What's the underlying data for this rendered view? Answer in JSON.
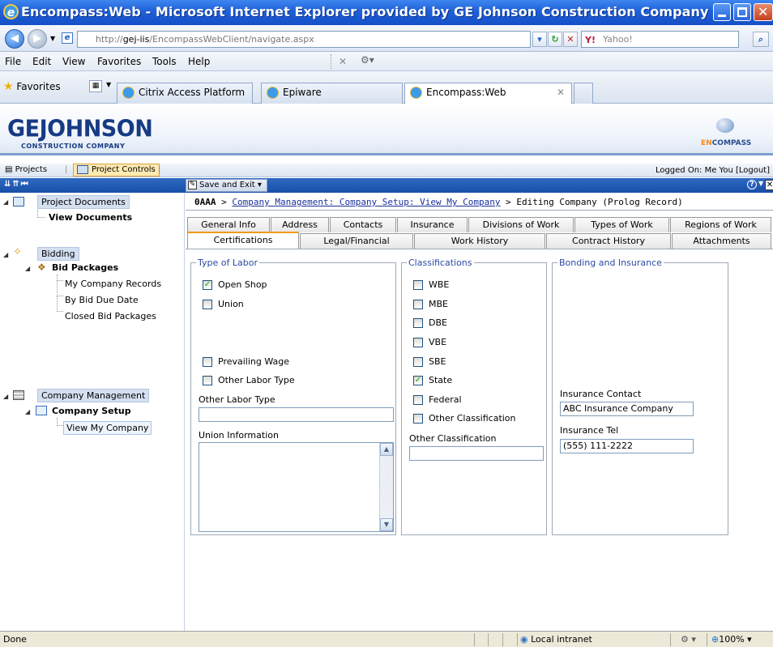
{
  "window": {
    "title": "Encompass:Web - Microsoft Internet Explorer provided by GE Johnson Construction Company"
  },
  "address": {
    "url_prefix": "http://",
    "url_host": "gej-iis",
    "url_path": "/EncompassWebClient/navigate.aspx",
    "search_placeholder": "Yahoo!"
  },
  "menu": [
    "File",
    "Edit",
    "View",
    "Favorites",
    "Tools",
    "Help"
  ],
  "favorites": {
    "label": "Favorites",
    "tabs": [
      "Citrix Access Platform",
      "Epiware",
      "Encompass:Web"
    ]
  },
  "app": {
    "logo_main": "GEJOHNSON",
    "logo_sub": "CONSTRUCTION COMPANY",
    "brand_en": "EN",
    "brand_rest": "COMPASS",
    "nav_projects": "Projects",
    "nav_project_controls": "Project Controls",
    "nav_separator": "|",
    "logged_on": "Logged On: Me You  [Logout]",
    "save_exit": "Save and Exit"
  },
  "tree": {
    "project_documents": "Project Documents",
    "view_documents": "View Documents",
    "bidding": "Bidding",
    "bid_packages": "Bid Packages",
    "my_company_records": "My Company Records",
    "by_bid_due_date": "By Bid Due Date",
    "closed_bid_packages": "Closed Bid Packages",
    "company_management": "Company Management",
    "company_setup": "Company Setup",
    "view_my_company": "View My Company"
  },
  "breadcrumb": {
    "root": "0AAA",
    "sep": " > ",
    "link": "Company Management: Company Setup: View My Company",
    "current": "Editing Company (Prolog Record)"
  },
  "tabs_row1": [
    "General Info",
    "Address",
    "Contacts",
    "Insurance",
    "Divisions of Work",
    "Types of Work",
    "Regions of Work"
  ],
  "tabs_row2": [
    "Certifications",
    "Legal/Financial",
    "Work History",
    "Contract History",
    "Attachments"
  ],
  "labor": {
    "legend": "Type of Labor",
    "open_shop": "Open Shop",
    "open_shop_checked": true,
    "union": "Union",
    "union_checked": false,
    "prevailing_wage": "Prevailing Wage",
    "prevailing_wage_checked": false,
    "other_labor_type": "Other Labor Type",
    "other_labor_type_checked": false,
    "other_labor_type_label": "Other Labor Type",
    "other_labor_type_value": "",
    "union_information_label": "Union Information",
    "union_information_value": ""
  },
  "classifications": {
    "legend": "Classifications",
    "items": [
      {
        "label": "WBE",
        "checked": false
      },
      {
        "label": "MBE",
        "checked": false
      },
      {
        "label": "DBE",
        "checked": false
      },
      {
        "label": "VBE",
        "checked": false
      },
      {
        "label": "SBE",
        "checked": false
      },
      {
        "label": "State",
        "checked": true
      },
      {
        "label": "Federal",
        "checked": false
      },
      {
        "label": "Other Classification",
        "checked": false
      }
    ],
    "other_classification_label": "Other Classification",
    "other_classification_value": ""
  },
  "bonding": {
    "legend": "Bonding and Insurance",
    "insurance_contact_label": "Insurance Contact",
    "insurance_contact_value": "ABC Insurance Company",
    "insurance_tel_label": "Insurance Tel",
    "insurance_tel_value": "(555) 111-2222"
  },
  "status": {
    "left": "Done",
    "zone": "Local intranet",
    "zoom": "100%"
  },
  "colors": {
    "titlebar": "#1f5fd7",
    "selected_tab_accent": "#f39a1a",
    "legend_blue": "#2a4aa0",
    "link_blue": "#1a2f9c"
  }
}
